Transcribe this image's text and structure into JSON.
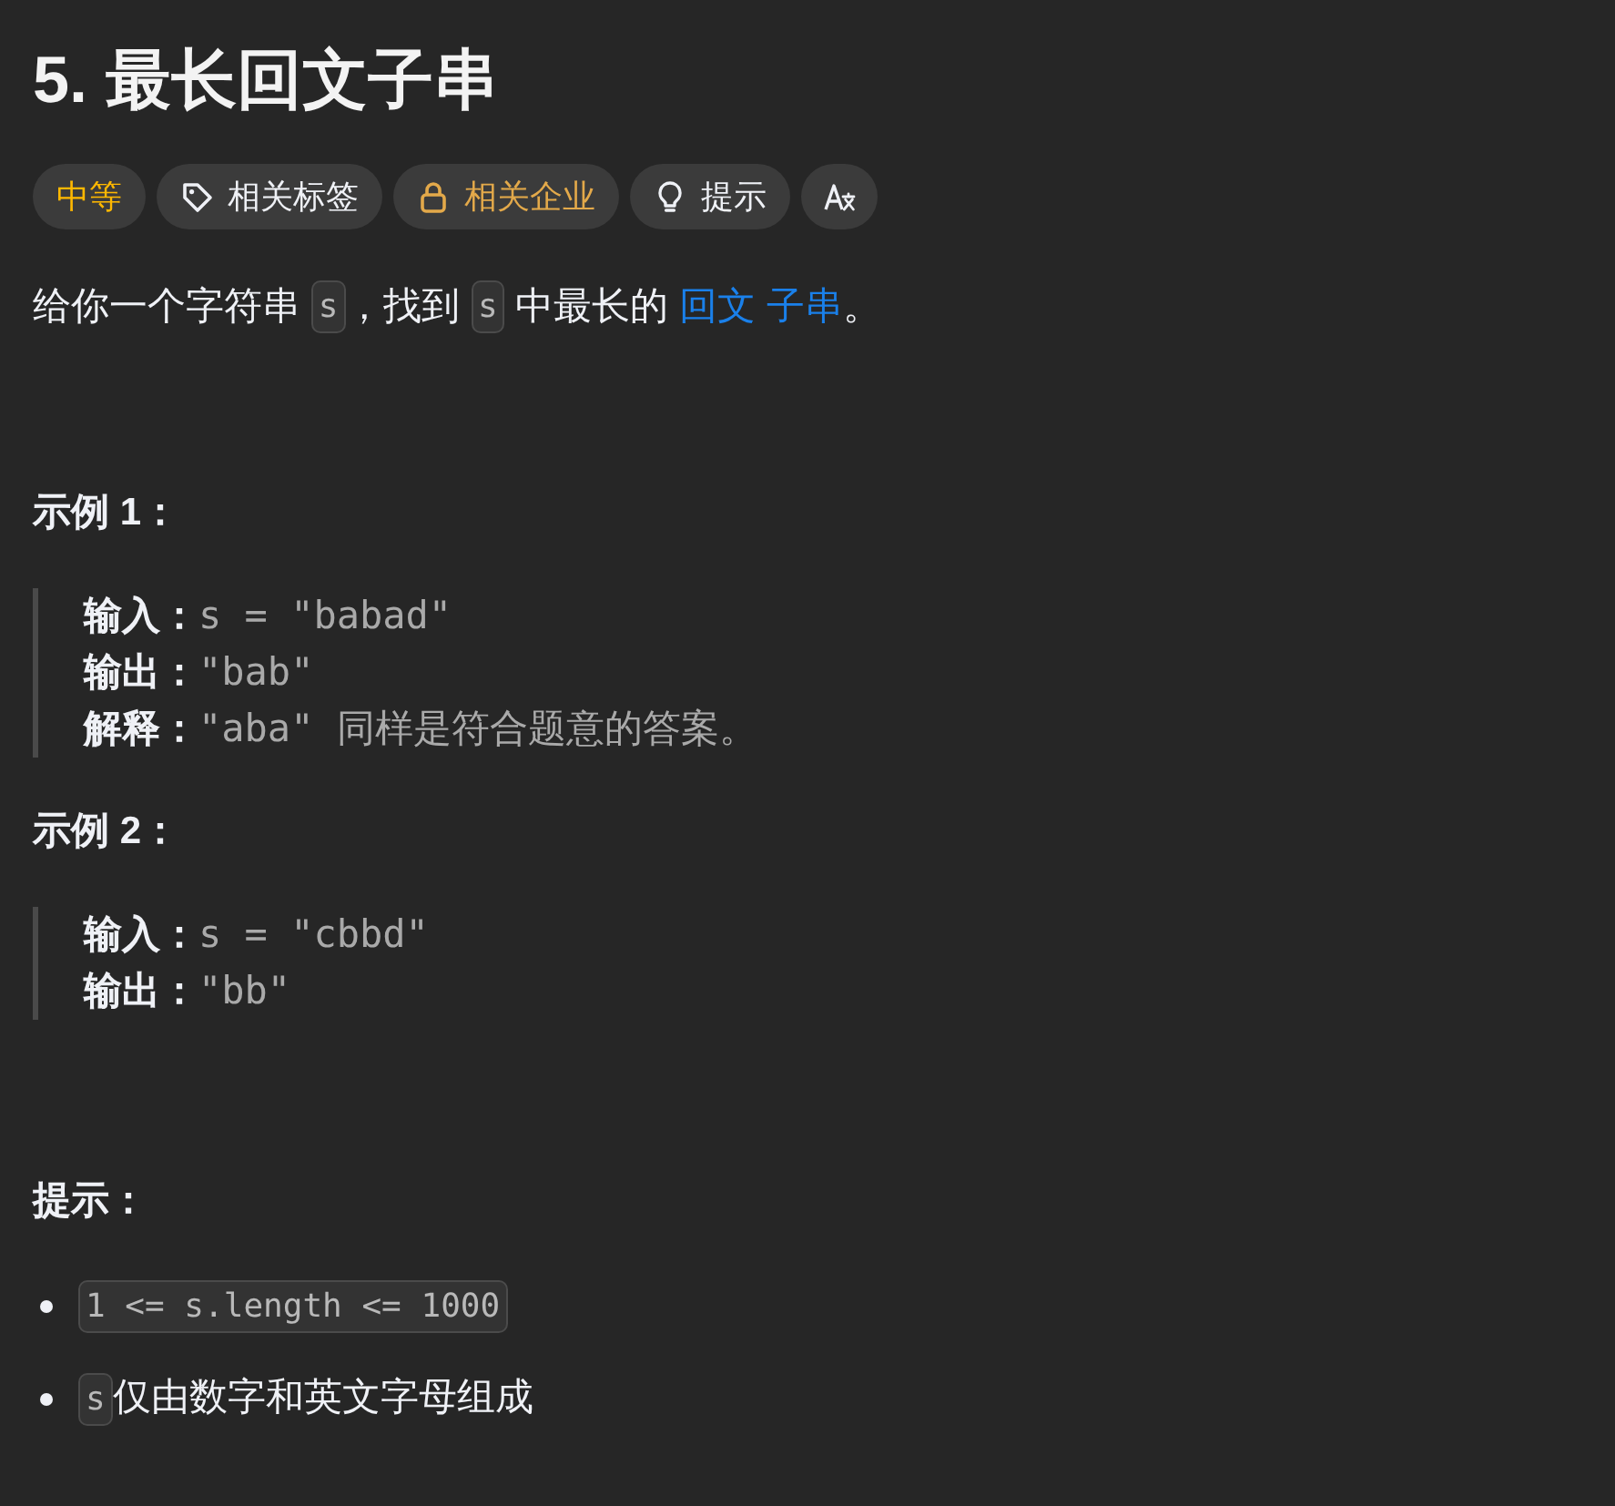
{
  "title": "5. 最长回文子串",
  "tags": [
    {
      "kind": "difficulty",
      "label": "中等"
    },
    {
      "kind": "topics",
      "label": "相关标签"
    },
    {
      "kind": "companies",
      "label": "相关企业"
    },
    {
      "kind": "hint",
      "label": "提示"
    },
    {
      "kind": "translate"
    }
  ],
  "description": [
    {
      "kind": "text",
      "text": "给你一个字符串 "
    },
    {
      "kind": "code",
      "text": "s"
    },
    {
      "kind": "text",
      "text": "，找到 "
    },
    {
      "kind": "code",
      "text": "s"
    },
    {
      "kind": "text",
      "text": " 中最长的 "
    },
    {
      "kind": "link",
      "text": "回文"
    },
    {
      "kind": "link",
      "text": "子串"
    },
    {
      "kind": "text",
      "text": "。"
    }
  ],
  "examples": [
    {
      "title": "示例 1：",
      "lines": [
        {
          "label": "输入：",
          "value": "s = \"babad\""
        },
        {
          "label": "输出：",
          "value": "\"bab\""
        },
        {
          "label": "解释：",
          "value": "\"aba\" 同样是符合题意的答案。"
        }
      ]
    },
    {
      "title": "示例 2：",
      "lines": [
        {
          "label": "输入：",
          "value": "s = \"cbbd\""
        },
        {
          "label": "输出：",
          "value": "\"bb\""
        }
      ]
    }
  ],
  "constraints": {
    "title": "提示：",
    "items": [
      {
        "parts": [
          {
            "kind": "code",
            "text": "1 <= s.length <= 1000"
          }
        ]
      },
      {
        "parts": [
          {
            "kind": "code",
            "text": "s"
          },
          {
            "kind": "text",
            "text": " 仅由数字和英文字母组成"
          }
        ]
      }
    ]
  }
}
